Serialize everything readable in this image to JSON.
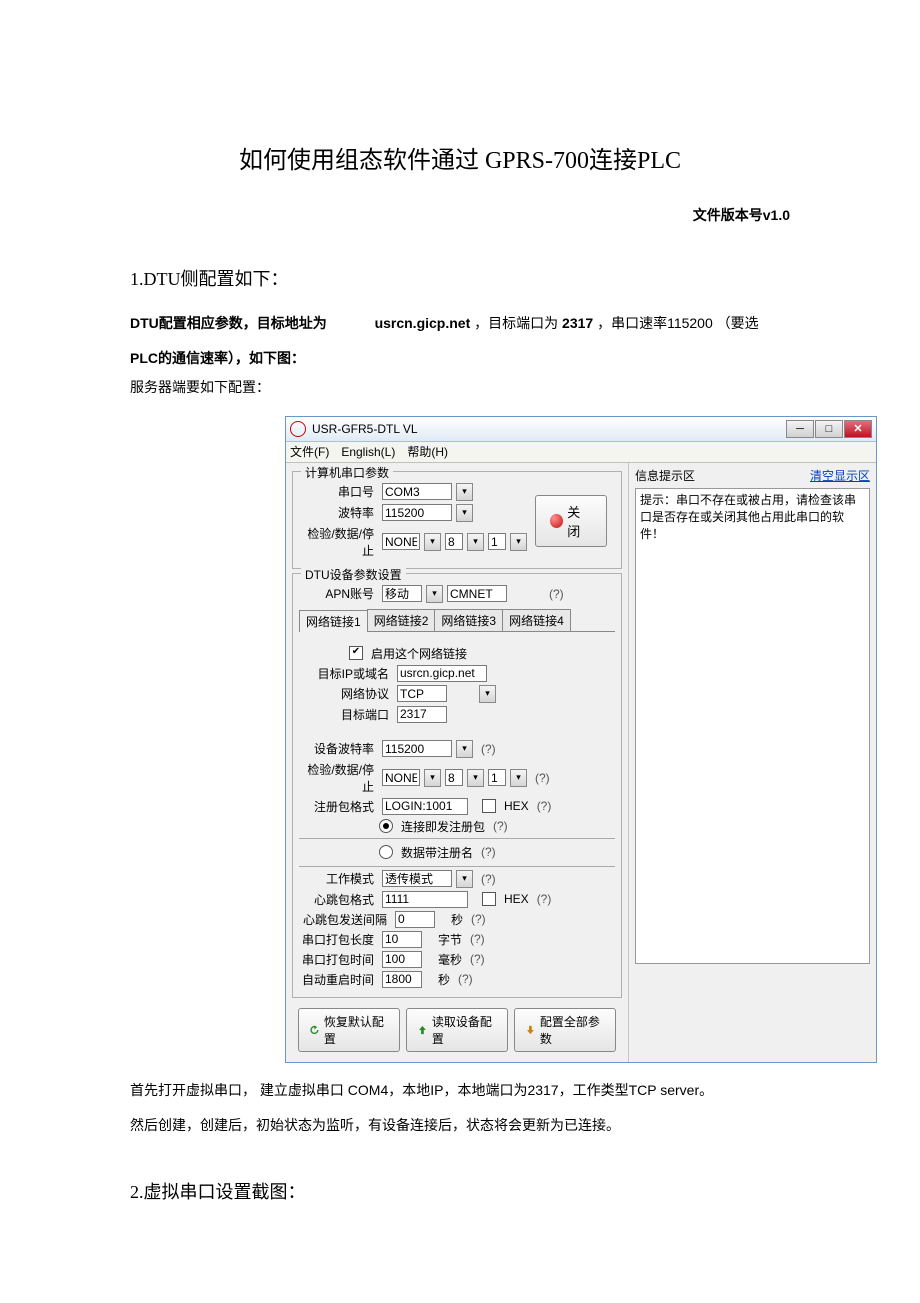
{
  "doc": {
    "title": "如何使用组态软件通过 GPRS-700连接PLC",
    "version": "文件版本号v1.0",
    "sec1": {
      "heading": "1.DTU侧配置如下：",
      "p1a": "DTU配置相应参数，目标地址为 ",
      "p1b": "usrcn.gicp.net",
      "p1c": "，目标端口为 ",
      "p1d": "2317",
      "p1e": "，串口速率115200 （要选",
      "p2": "PLC的通信速率），如下图：",
      "p3": "服务器端要如下配置：",
      "after1": "首先打开虚拟串口， 建立虚拟串口 COM4，本地IP，本地端口为2317，工作类型TCP server。",
      "after2": "然后创建，创建后，初始状态为监听，有设备连接后，状态将会更新为已连接。"
    },
    "sec2": {
      "heading": "2.虚拟串口设置截图："
    }
  },
  "app": {
    "title": "USR-GFR5-DTL VL",
    "menu": {
      "file": "文件(F)",
      "english": "English(L)",
      "help": "帮助(H)"
    },
    "comParams": {
      "legend": "计算机串口参数",
      "portLbl": "串口号",
      "portVal": "COM3",
      "baudLbl": "波特率",
      "baudVal": "115200",
      "parityLbl": "检验/数据/停止",
      "parityVal": "NONE",
      "dataVal": "8",
      "stopVal": "1",
      "closeBtn": "关闭"
    },
    "dtu": {
      "legend": "DTU设备参数设置",
      "apnLbl": "APN账号",
      "apnSel": "移动",
      "apnVal": "CMNET",
      "tabs": [
        "网络链接1",
        "网络链接2",
        "网络链接3",
        "网络链接4"
      ],
      "enableChk": "启用这个网络链接",
      "ipLbl": "目标IP或域名",
      "ipVal": "usrcn.gicp.net",
      "protoLbl": "网络协议",
      "protoVal": "TCP",
      "portLbl": "目标端口",
      "portVal": "2317",
      "devBaudLbl": "设备波特率",
      "devBaudVal": "115200",
      "devParityLbl": "检验/数据/停止",
      "devParityVal": "NONE",
      "devDataVal": "8",
      "devStopVal": "1",
      "regLbl": "注册包格式",
      "regVal": "LOGIN:1001",
      "hexLbl": "HEX",
      "radio1": "连接即发注册包",
      "radio2": "数据带注册名",
      "modeLbl": "工作模式",
      "modeVal": "透传模式",
      "heartFmtLbl": "心跳包格式",
      "heartFmtVal": "1111",
      "hex2": "HEX",
      "heartIntLbl": "心跳包发送间隔",
      "heartIntVal": "0",
      "heartIntUnit": "秒",
      "packLenLbl": "串口打包长度",
      "packLenVal": "10",
      "packLenUnit": "字节",
      "packTimeLbl": "串口打包时间",
      "packTimeVal": "100",
      "packTimeUnit": "毫秒",
      "rebootLbl": "自动重启时间",
      "rebootVal": "1800",
      "rebootUnit": "秒"
    },
    "footer": {
      "restore": "恢复默认配置",
      "read": "读取设备配置",
      "write": "配置全部参数"
    },
    "info": {
      "legend": "信息提示区",
      "clear": "清空显示区",
      "msg": "提示：串口不存在或被占用，请检查该串口是否存在或关闭其他占用此串口的软件！"
    },
    "q": "(?)"
  }
}
